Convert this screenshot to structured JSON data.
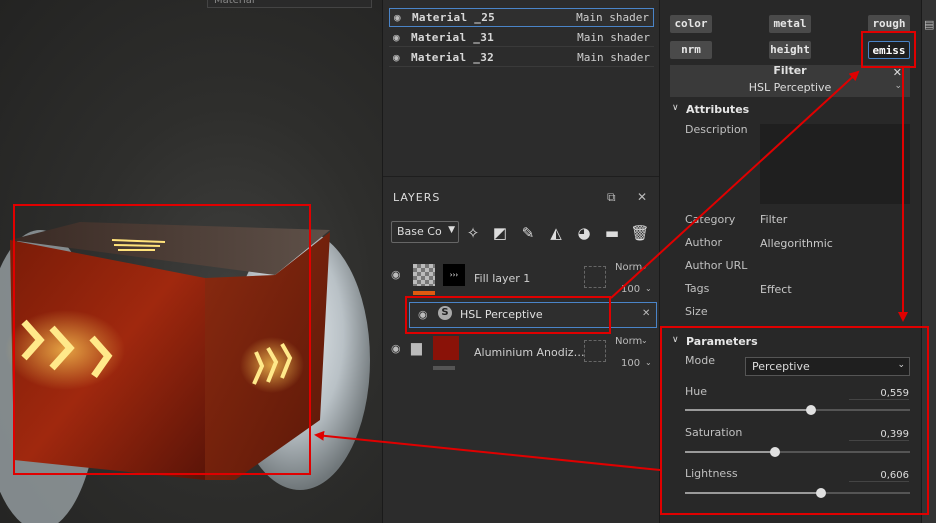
{
  "viewport": {
    "top_field": "Material"
  },
  "materials": [
    {
      "name": "Material _25",
      "shader": "Main shader",
      "selected": true
    },
    {
      "name": "Material _31",
      "shader": "Main shader",
      "selected": false
    },
    {
      "name": "Material _32",
      "shader": "Main shader",
      "selected": false
    }
  ],
  "layers_panel": {
    "title": "LAYERS",
    "channel_select": "Base Co",
    "layers": [
      {
        "name": "Fill layer 1",
        "blend": "Norm",
        "opacity": "100"
      },
      {
        "name": "HSL Perceptive",
        "type": "filter"
      },
      {
        "name": "Aluminium Anodiz…",
        "blend": "Norm",
        "opacity": "100"
      }
    ]
  },
  "channels": {
    "buttons": [
      "color",
      "metal",
      "rough",
      "nrm",
      "height",
      "emiss"
    ],
    "active": "emiss"
  },
  "filter": {
    "title": "Filter",
    "value": "HSL Perceptive"
  },
  "attributes": {
    "title": "Attributes",
    "description_label": "Description",
    "rows": [
      {
        "label": "Category",
        "value": "Filter"
      },
      {
        "label": "Author",
        "value": "Allegorithmic"
      },
      {
        "label": "Author URL",
        "value": ""
      },
      {
        "label": "Tags",
        "value": "Effect"
      },
      {
        "label": "Size",
        "value": ""
      }
    ]
  },
  "parameters": {
    "title": "Parameters",
    "mode_label": "Mode",
    "mode_value": "Perceptive",
    "sliders": [
      {
        "label": "Hue",
        "value": "0,559",
        "fraction": 0.559
      },
      {
        "label": "Saturation",
        "value": "0,399",
        "fraction": 0.399
      },
      {
        "label": "Lightness",
        "value": "0,606",
        "fraction": 0.606
      }
    ]
  },
  "colors": {
    "annotation_red": "#e00000",
    "selection_blue": "#4a84c8",
    "emissive_glow": "#ffd24a",
    "box_red": "#8a1a0a"
  }
}
